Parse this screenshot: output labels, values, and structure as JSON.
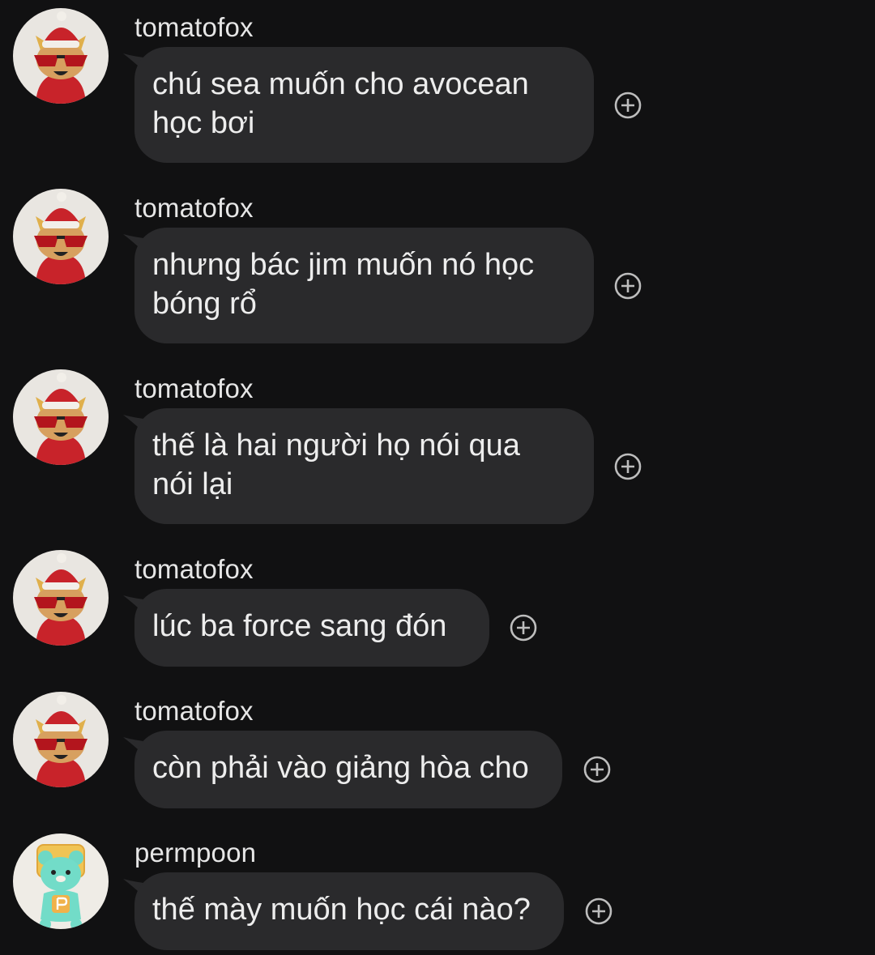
{
  "messages": [
    {
      "sender": "tomatofox",
      "line1": "chú sea muốn cho avocean",
      "line2": "học bơi",
      "avatar_icon": "red-fox-plush-avatar"
    },
    {
      "sender": "tomatofox",
      "line1": "nhưng bác jim muốn nó học",
      "line2": "bóng rổ",
      "avatar_icon": "red-fox-plush-avatar"
    },
    {
      "sender": "tomatofox",
      "line1": "thế là hai người họ nói qua",
      "line2": "nói lại",
      "avatar_icon": "red-fox-plush-avatar"
    },
    {
      "sender": "tomatofox",
      "line1": "lúc ba force sang đón",
      "line2": "",
      "avatar_icon": "red-fox-plush-avatar"
    },
    {
      "sender": "tomatofox",
      "line1": "còn phải vào giảng hòa cho",
      "line2": "",
      "avatar_icon": "red-fox-plush-avatar"
    },
    {
      "sender": "permpoon",
      "line1": "thế mày muốn học cái nào?",
      "line2": "",
      "avatar_icon": "mint-bear-plush-avatar"
    }
  ],
  "colors": {
    "background": "#111112",
    "bubble": "#2a2a2c",
    "text": "#ededed",
    "react_icon": "#bdbdbd"
  },
  "icons": {
    "react": "add-reaction-icon"
  }
}
